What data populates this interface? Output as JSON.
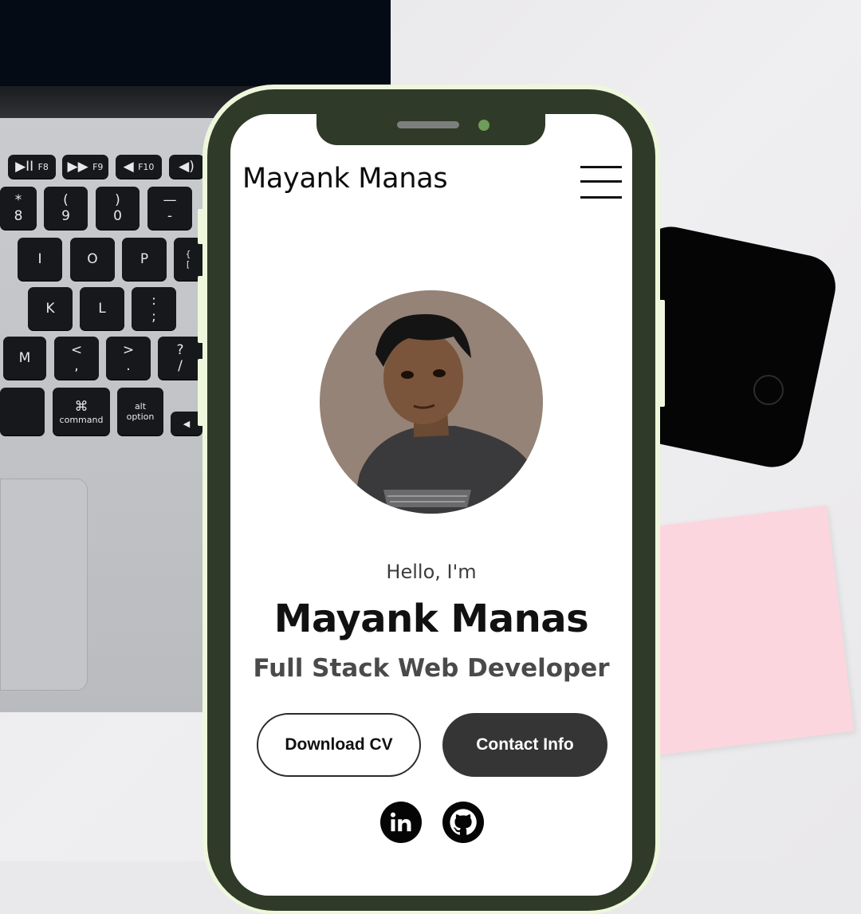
{
  "header": {
    "brand": "Mayank Manas",
    "menu_icon": "hamburger-menu-icon"
  },
  "hero": {
    "greeting": "Hello, I'm",
    "name": "Mayank Manas",
    "role": "Full Stack Web Developer"
  },
  "buttons": {
    "download_cv": "Download CV",
    "contact_info": "Contact Info"
  },
  "social": {
    "linkedin_icon": "linkedin-icon",
    "github_icon": "github-icon"
  },
  "keyboard": {
    "keys": [
      "▶II",
      "F8",
      "▶▶",
      "F9",
      "◀",
      "F10",
      "◀)",
      "*",
      "8",
      "(",
      "9",
      ")",
      "0",
      "—",
      "-",
      "I",
      "O",
      "P",
      "{",
      "[",
      "K",
      "L",
      ":",
      ";",
      "M",
      "<",
      ",",
      ">",
      ".",
      "?",
      "/",
      "⌘",
      "command",
      "alt",
      "option",
      "◀"
    ]
  },
  "colors": {
    "phone_frame": "#2f3a29",
    "phone_rim": "#eef7dc",
    "camera": "#6e9c5a",
    "contact_button": "#353535",
    "avatar_background": "#948376",
    "sticky_note": "#fcd6de"
  }
}
